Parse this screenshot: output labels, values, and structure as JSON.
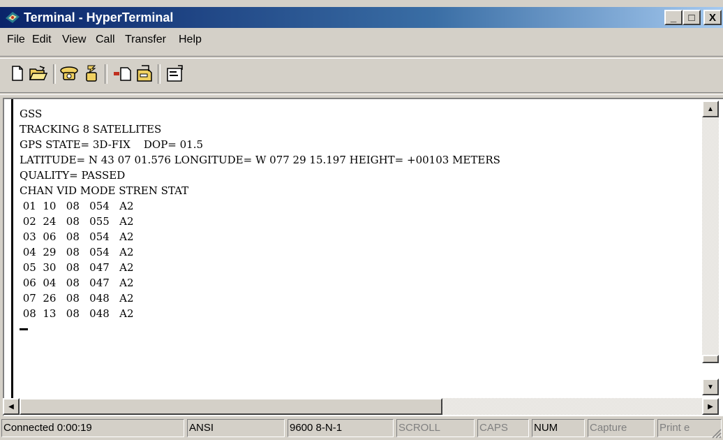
{
  "window": {
    "title": "Terminal - HyperTerminal",
    "controls": {
      "minimize": "_",
      "maximize": "□",
      "close": "X"
    }
  },
  "menu": [
    "File",
    "Edit",
    "View",
    "Call",
    "Transfer",
    "Help"
  ],
  "toolbar": {
    "buttons": [
      "new-icon",
      "open-icon",
      "connect-icon",
      "disconnect-icon",
      "send-icon",
      "receive-icon",
      "properties-icon"
    ]
  },
  "terminal": {
    "lines": [
      "GSS",
      "TRACKING 8 SATELLITES",
      "GPS STATE= 3D-FIX    DOP= 01.5",
      "LATITUDE= N 43 07 01.576 LONGITUDE= W 077 29 15.197 HEIGHT= +00103 METERS",
      "QUALITY= PASSED",
      "CHAN VID MODE STREN STAT",
      " 01  10   08   054   A2",
      " 02  24   08   055   A2",
      " 03  06   08   054   A2",
      " 04  29   08   054   A2",
      " 05  30   08   047   A2",
      " 06  04   08   047   A2",
      " 07  26   08   048   A2",
      " 08  13   08   048   A2"
    ]
  },
  "status": {
    "connected": "Connected 0:00:19",
    "emulation": "ANSI",
    "settings": "9600 8-N-1",
    "scroll": "SCROLL",
    "caps": "CAPS",
    "num": "NUM",
    "capture": "Capture",
    "print": "Print e"
  },
  "colors": {
    "titlebar_start": "#0a246a",
    "titlebar_end": "#a6caf0",
    "chrome": "#d4d0c8",
    "terminal_bg": "#ffffff"
  }
}
